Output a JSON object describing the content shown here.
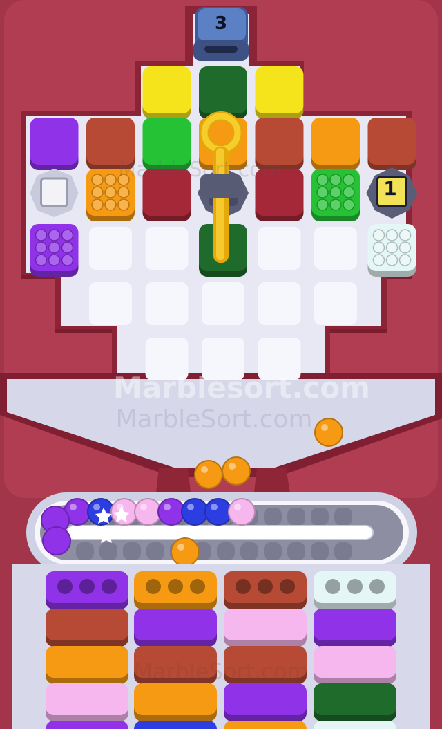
{
  "board": {
    "rows": [
      [
        null,
        null,
        null,
        "yellow",
        "darkgreen",
        "yellow",
        null,
        null,
        null
      ],
      [
        null,
        "purple",
        "rust",
        "green",
        "orange",
        "rust",
        "orange",
        "rust",
        null
      ],
      [
        null,
        "empty-slot",
        "orange-box",
        "maroon",
        "lock",
        "maroon",
        "green-box",
        "locked-1",
        null
      ],
      [
        null,
        "purple-box",
        "empty",
        "empty",
        "darkgreen",
        "empty",
        "empty",
        "white-box",
        null
      ],
      [
        null,
        null,
        "empty",
        "empty",
        "empty",
        "empty",
        "empty",
        null,
        null
      ],
      [
        null,
        null,
        null,
        "empty",
        "empty",
        "empty",
        null,
        null,
        null
      ]
    ]
  },
  "counters": {
    "top_remaining": "3",
    "locked_tile": "1"
  },
  "conveyor": {
    "top_row": [
      "purple",
      "blue",
      "pink",
      "pink",
      "purple",
      "blue",
      "blue",
      "pink"
    ],
    "left_end": [
      "purple",
      "purple"
    ],
    "dropping": [
      "orange",
      "orange",
      "orange",
      "orange"
    ]
  },
  "trays": [
    [
      "purple-open",
      "rust",
      "orange",
      "pink",
      "purple"
    ],
    [
      "orange-open",
      "purple",
      "rust",
      "orange",
      "blue"
    ],
    [
      "rust-open",
      "pink",
      "rust",
      "purple",
      "orange"
    ],
    [
      "white-open",
      "purple",
      "pink",
      "darkgreen",
      "white"
    ]
  ],
  "palette": {
    "yellow": "#f5e31c",
    "darkgreen": "#1f6b2c",
    "green": "#25c236",
    "purple": "#8f32e8",
    "rust": "#b64a35",
    "orange": "#f59a12",
    "maroon": "#a42838",
    "pink": "#f6b7ee",
    "blue": "#2c3ee2",
    "white": "#e5f6f6"
  },
  "watermarks": {
    "main": "Marblesort.com",
    "secondary": "MarbleSort.com",
    "tiles": "MarbleSort.com"
  }
}
